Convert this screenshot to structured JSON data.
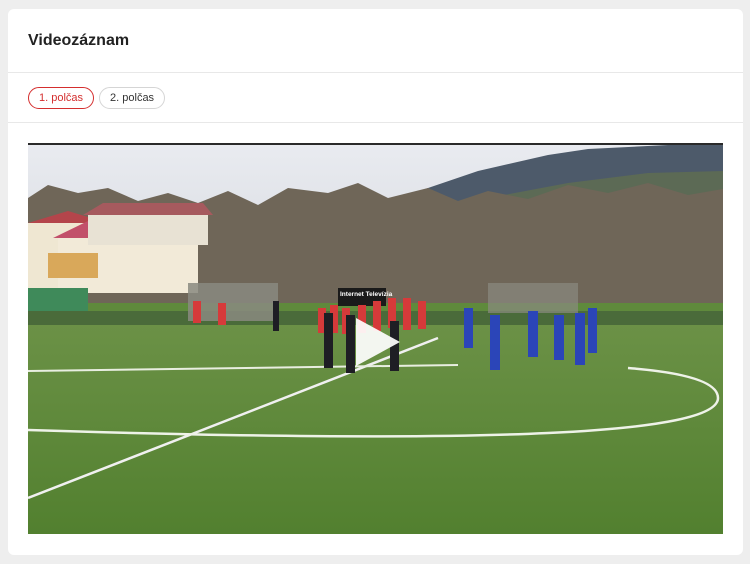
{
  "card": {
    "title": "Videozáznam"
  },
  "tabs": [
    {
      "label": "1. polčas",
      "active": true
    },
    {
      "label": "2. polčas",
      "active": false
    }
  ],
  "video": {
    "banner_text": "Internet Televízia",
    "play_icon": "play-icon"
  },
  "colors": {
    "accent": "#d42e2e",
    "card_bg": "#ffffff",
    "page_bg": "#eeeeee"
  }
}
